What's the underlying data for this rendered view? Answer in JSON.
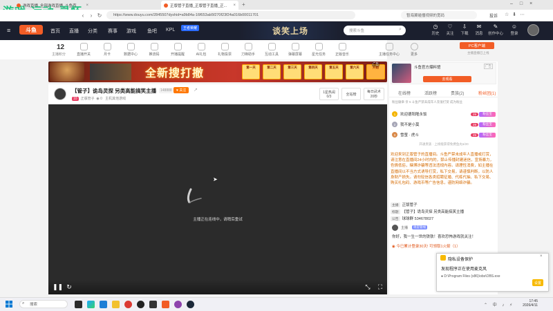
{
  "browser": {
    "tabs": [
      {
        "label": "游戏直播_全部游戏直播_斗鱼直..."
      },
      {
        "label": "正版管子直播_正版管子直播_正..."
      }
    ],
    "url": "https://www.douyu.com/2845507dyshid=a9b84a-16f653ab5f270f23f24a016b00011701",
    "search_hint": "暂海翼碰撞视频的宽码",
    "login_label": "投诉"
  },
  "watermark": "游戏 运动 灵怀",
  "site": {
    "logo": "斗鱼",
    "nav": [
      "首页",
      "直播",
      "分类",
      "赛事",
      "游戏",
      "鱼吧",
      "KPL"
    ],
    "kpl_badge": "王者荣耀",
    "center_banner": "谈笑上场",
    "search_placeholder": "搜索斗鱼",
    "header_icons": [
      "历史",
      "关注",
      "下载",
      "消息",
      "创作中心",
      "登录"
    ]
  },
  "categories": {
    "level": "12",
    "level_label": "主播积分",
    "items": [
      "直播开关",
      "月卡",
      "数据中心",
      "推流码",
      "开播提醒",
      "AI礼包",
      "礼物投票",
      "刀锋助手",
      "互动工具",
      "弹幕屏幕",
      "星光任务",
      "正版音乐",
      "主播任务中心",
      "更多"
    ]
  },
  "ad_banner": {
    "title": "全新搜打撤",
    "boxes": [
      "第一天",
      "第二天",
      "第三天",
      "第四天",
      "第五天",
      "第六天",
      "开始"
    ],
    "tag": "广告"
  },
  "streamer": {
    "title": "【管子】诡岛灵探 另类高能搞笑主播",
    "room_id": "148888",
    "follow": "关注",
    "name": "正版管子",
    "meta": "主机其他游戏",
    "box1_top": "1星热闹",
    "box1_bottom": "0/3",
    "box2": "全站榜",
    "box3_top": "每日武术",
    "box3_bottom": "20秒"
  },
  "video": {
    "message": "主播正在连线中，请稍后重试"
  },
  "right_panel": {
    "ad_title": "斗鱼官方爆料馆",
    "ad_tag": "广告",
    "ad_button": "去观看",
    "tabs": [
      "在线榜",
      "活跃榜",
      "贵族(2)",
      "粉丝团(1)"
    ],
    "rank_header": "粉丝徽章 亲  5 斗鱼严禁未成年人充值打赏  成为粉丝",
    "ranks": [
      {
        "num": "1",
        "name": "欢迎德阳隆永饭",
        "badge": "29",
        "gift": "粉丝宝"
      },
      {
        "num": "2",
        "name": "我不是小莫",
        "badge": "29",
        "gift": "粉丝宝"
      },
      {
        "num": "3",
        "name": "雪萤 · 虎斗",
        "badge": "29",
        "gift": "粉丝宝"
      }
    ],
    "rank_footer": "开通贵族 · 上榜能获得免费鱼丸5/20",
    "notice": "欢迎来到正版管子的直播间。斗鱼严禁未成年人直播或打赏，请注意在直播间24小时内的，禁止传播封建迷信，宣扬暴力，色情低俗，赌博诈骗等违法违规内容。请理性消费，如主播在直播间以不当方式诱导打赏，私下交易，请谨慎判断，以防人身财产损失。请勿轻信各类招聘征婚、代练代抽、私下交易、购买礼包码、游戏币等广告信息，谨防网络诈骗。",
    "info_rows": [
      {
        "label": "主播",
        "value": "正版管子"
      },
      {
        "label": "标题",
        "value": "【管子】诡岛灵探 另类高能搞笑主播"
      },
      {
        "label": "公告",
        "value": "球球群 534678027"
      }
    ],
    "chat_name": "主播",
    "chat_badge": "现官管线",
    "chat_msg": "你好，我一生一世的铁铁！喜欢恐怖游戏就关注！",
    "signin": "今已累计登录30天! 可领取1火箭（1）"
  },
  "right_side": {
    "pc_button": "PC客户端",
    "mini": "主播直播已上线"
  },
  "notification": {
    "title": "隐私设备保护",
    "subtitle": "发现程序正在使用麦克风",
    "path": "D:\\Program Files (x86)\\obs\\OBS.exe",
    "button": "设置"
  },
  "taskbar": {
    "search": "搜索",
    "time": "17:45",
    "date": "2026/4/11"
  },
  "colors": {
    "brand": "#f25d26",
    "dark_header": "#1b1f2e"
  }
}
